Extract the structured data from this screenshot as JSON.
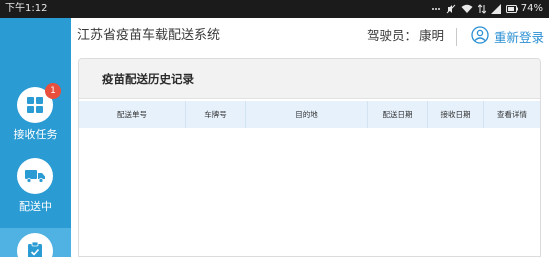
{
  "status_bar": {
    "time": "下午1:12",
    "battery": "74%"
  },
  "colors": {
    "accent": "#2b9bd3",
    "sidebar_active": "#4fb2e2",
    "link": "#2b8fd3",
    "badge": "#e84f3c",
    "table_header": "#e6f1fb"
  },
  "sidebar": {
    "items": [
      {
        "label": "接收任务",
        "icon": "grid-icon",
        "badge": "1"
      },
      {
        "label": "配送中",
        "icon": "truck-icon"
      },
      {
        "label": "",
        "icon": "clipboard-check-icon",
        "active": true
      }
    ]
  },
  "header": {
    "title": "江苏省疫苗车载配送系统",
    "driver_label": "驾驶员：",
    "driver_name": "康明",
    "relogin_label": "重新登录",
    "relogin_icon": "user-circle-icon"
  },
  "panel": {
    "title": "疫苗配送历史记录",
    "columns": [
      "配送单号",
      "车牌号",
      "目的地",
      "配送日期",
      "接收日期",
      "查看详情"
    ],
    "rows": []
  }
}
